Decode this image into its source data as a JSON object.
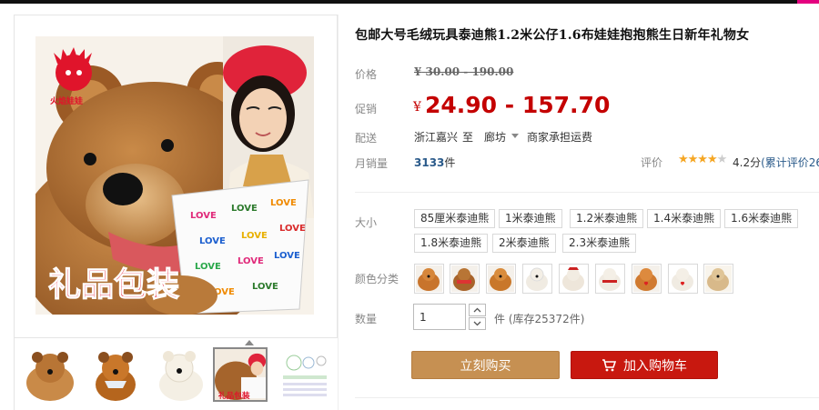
{
  "product": {
    "title": "包邮大号毛绒玩具泰迪熊1.2米公仔1.6布娃娃抱抱熊生日新年礼物女",
    "brand_logo_text": "火焰娃娃",
    "gift_pack_text": "礼品包装",
    "bag_text": "LOVE"
  },
  "price": {
    "label": "价格",
    "currency": "¥",
    "original": "30.00 - 190.00"
  },
  "promo": {
    "label": "促销",
    "currency": "¥",
    "price": "24.90 - 157.70"
  },
  "shipping": {
    "label": "配送",
    "from": "浙江嘉兴",
    "to_label": "至",
    "city": "廊坊",
    "fee": "商家承担运费"
  },
  "sales": {
    "label": "月销量",
    "count": "3133",
    "unit": "件"
  },
  "rating": {
    "label": "评价",
    "stars": "★★★★",
    "half_star": "★",
    "score": "4.2分",
    "review_link": "(累计评价26"
  },
  "size": {
    "label": "大小",
    "options": [
      "85厘米泰迪熊",
      "1米泰迪熊",
      "1.2米泰迪熊",
      "1.4米泰迪熊",
      "1.6米泰迪熊",
      "1.8米泰迪熊",
      "2米泰迪熊",
      "2.3米泰迪熊"
    ]
  },
  "color": {
    "label": "颜色分类",
    "swatches": [
      "orange-bear",
      "brown-bear-red-scarf",
      "brown-bear",
      "white-bear",
      "white-bear-red-hat",
      "white-bear-red-scarf",
      "orange-bear-heart",
      "white-bear-heart",
      "tan-bear"
    ]
  },
  "quantity": {
    "label": "数量",
    "value": "1",
    "unit": "件",
    "stock": "(库存25372件)"
  },
  "actions": {
    "buy_now": "立刻购买",
    "add_to_cart": "加入购物车"
  },
  "colors": {
    "promo_red": "#c40000",
    "buy_btn": "#c69052",
    "cart_btn": "#c8180f",
    "link_blue": "#2a5a8a"
  }
}
